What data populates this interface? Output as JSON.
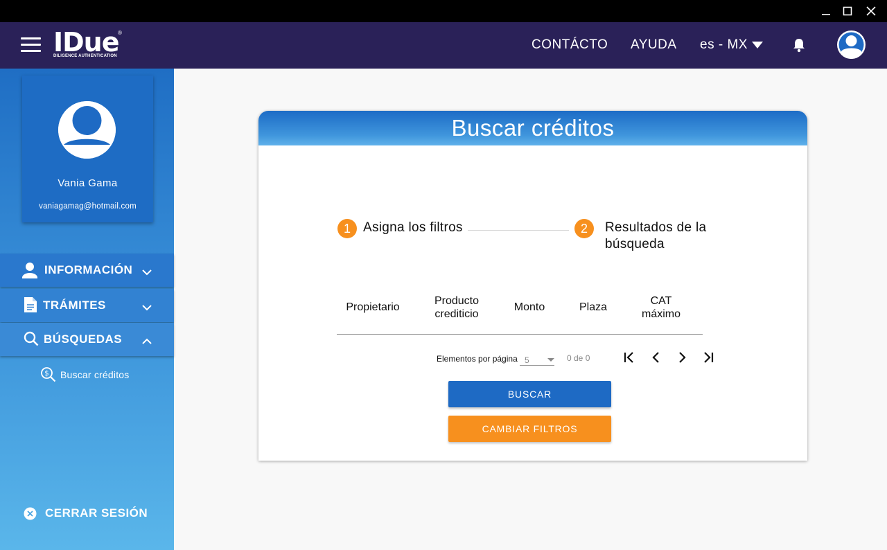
{
  "window": {
    "minimize_icon": "minimize-icon",
    "maximize_icon": "maximize-icon",
    "close_icon": "close-icon"
  },
  "topnav": {
    "logo_text": "IDue",
    "logo_mark": "®",
    "logo_tagline": "DILIGENCE AUTHENTICATION",
    "contacto": "CONTÁCTO",
    "ayuda": "AYUDA",
    "language": "es - MX",
    "bg_color": "#2a2158"
  },
  "sidebar": {
    "user_name": "Vania Gama",
    "user_email": "vaniagamag@hotmail.com",
    "menu": [
      {
        "label": "INFORMACIÓN",
        "icon": "user-icon",
        "expanded": false
      },
      {
        "label": "TRÁMITES",
        "icon": "document-icon",
        "expanded": false
      },
      {
        "label": "BÚSQUEDAS",
        "icon": "search-icon",
        "expanded": true
      }
    ],
    "submenu_item": "Buscar créditos",
    "logout": "CERRAR SESIÓN"
  },
  "main": {
    "title": "Buscar créditos",
    "steps": [
      {
        "number": "1",
        "label": "Asigna los filtros"
      },
      {
        "number": "2",
        "label": "Resultados de la búsqueda"
      }
    ],
    "columns": [
      "Propietario",
      "Producto crediticio",
      "Monto",
      "Plaza",
      "CAT máximo"
    ],
    "pagination": {
      "label": "Elementos por página",
      "page_size": "5",
      "count": "0 de 0"
    },
    "buttons": {
      "buscar": "BUSCAR",
      "cambiar": "CAMBIAR FILTROS"
    },
    "colors": {
      "primary": "#1e6ac4",
      "accent": "#f7901e"
    }
  }
}
